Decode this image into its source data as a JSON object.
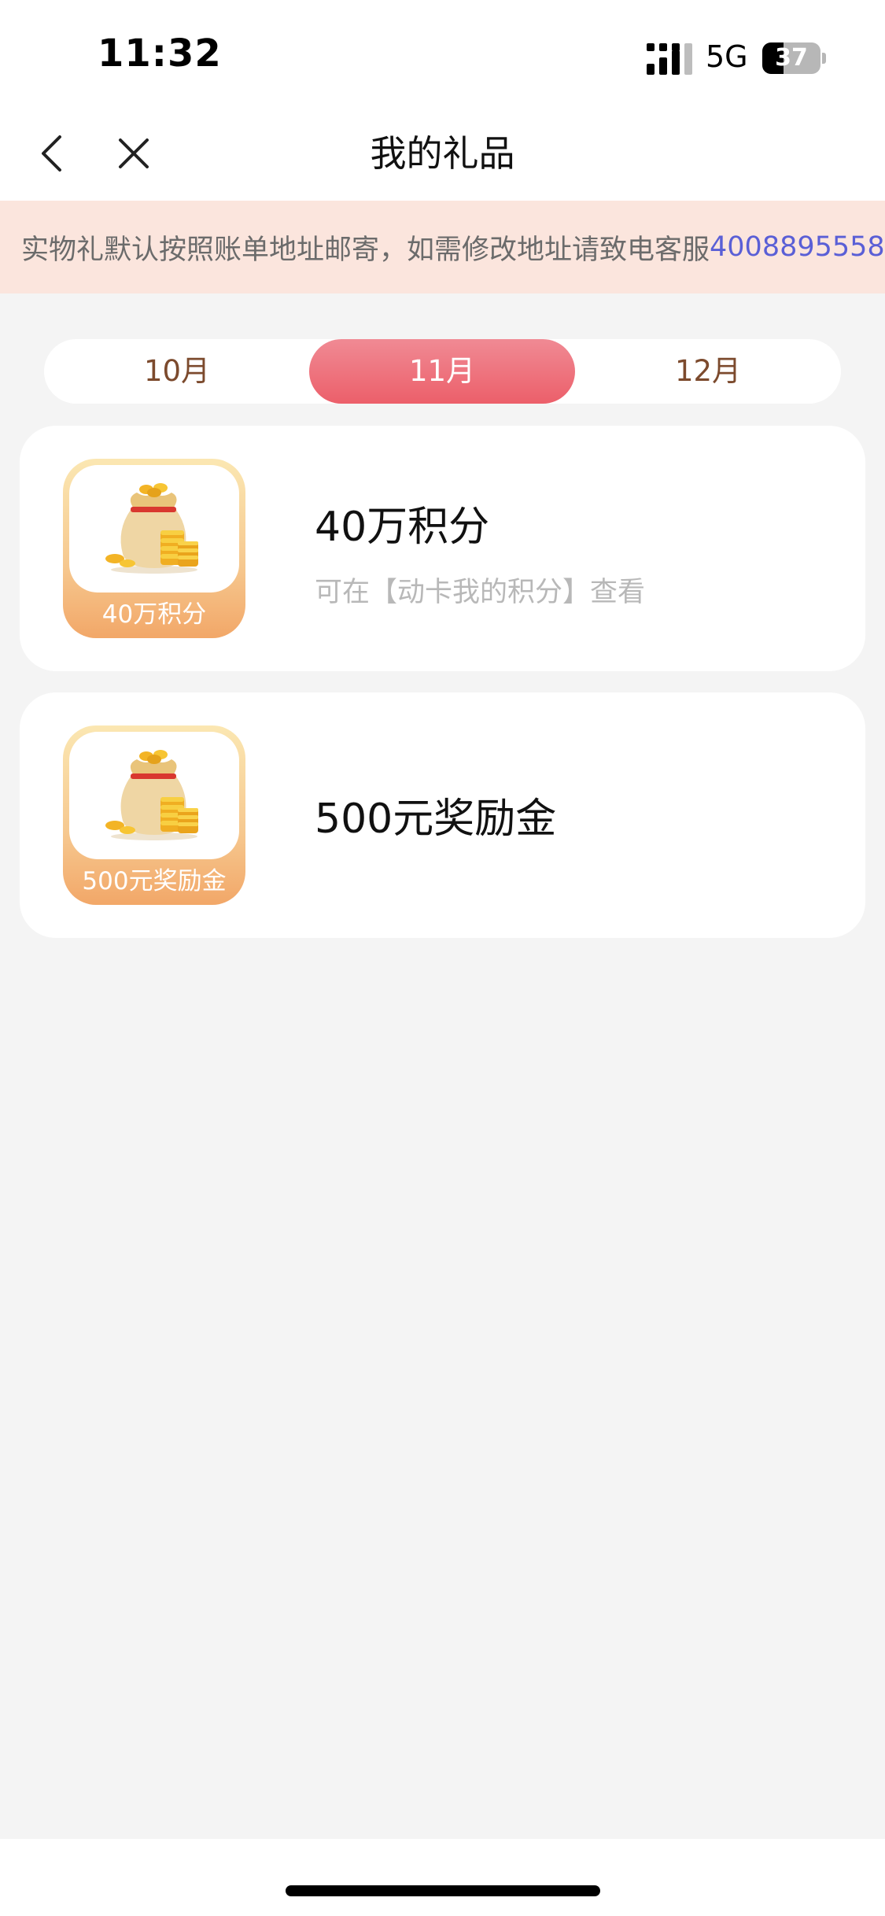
{
  "status_bar": {
    "time": "11:32",
    "network": "5G",
    "battery_level": "37",
    "battery_fraction": 0.37
  },
  "nav": {
    "title": "我的礼品",
    "back_icon": "chevron-left-icon",
    "close_icon": "close-icon"
  },
  "notice": {
    "text": "实物礼默认按照账单地址邮寄，如需修改地址请致电客服",
    "phone": "4008895558",
    "phone_color": "#5a5fd6"
  },
  "month_tabs": {
    "items": [
      {
        "label": "10月",
        "active": false
      },
      {
        "label": "11月",
        "active": true
      },
      {
        "label": "12月",
        "active": false
      }
    ],
    "active_color": "#ec5f6a"
  },
  "gifts": [
    {
      "thumb_label": "40万积分",
      "name": "40万积分",
      "desc": "可在【动卡我的积分】查看",
      "icon": "money-bag-coins-icon"
    },
    {
      "thumb_label": "500元奖励金",
      "name": "500元奖励金",
      "desc": "",
      "icon": "money-bag-coins-icon"
    }
  ]
}
